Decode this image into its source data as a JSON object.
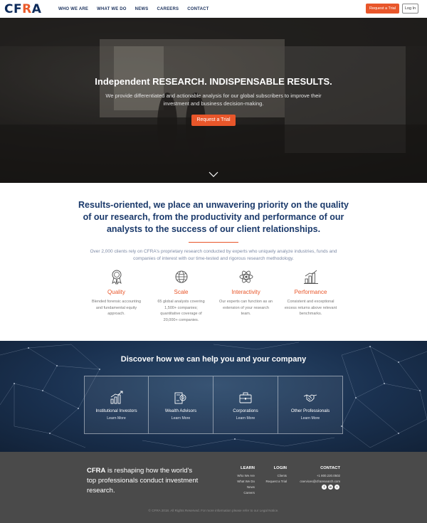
{
  "nav": {
    "logo_main": "CF",
    "logo_accent": "R",
    "logo_end": "A",
    "links": [
      "WHO WE ARE",
      "WHAT WE DO",
      "NEWS",
      "CAREERS",
      "CONTACT"
    ],
    "trial_label": "Request a Trial",
    "login_label": "Log In"
  },
  "hero": {
    "title": "Independent RESEARCH. INDISPENSABLE RESULTS.",
    "subtitle": "We provide differentiated and actionable analysis for our global subscribers to improve their investment and business decision-making.",
    "cta_label": "Request a Trial"
  },
  "results": {
    "heading": "Results-oriented, we place an unwavering priority on the quality of our research, from the productivity and performance of our analysts to the success of our client relationships.",
    "body": "Over 2,000 clients rely on CFRA's proprietary research conducted by experts who uniquely analyze industries, funds and companies of interest with our time-tested and rigorous research methodology.",
    "features": [
      {
        "title": "Quality",
        "desc": "Blended forensic accounting and fundamental equity approach.",
        "icon": "award-ribbon-icon"
      },
      {
        "title": "Scale",
        "desc": "65 global analysts covering 1,500+ companies; quantitative coverage of 20,000+ companies.",
        "icon": "globe-icon"
      },
      {
        "title": "Interactivity",
        "desc": "Our experts can function as an extension of your research team.",
        "icon": "atom-icon"
      },
      {
        "title": "Performance",
        "desc": "Consistent and exceptional excess returns above relevant benchmarks.",
        "icon": "bar-chart-icon"
      }
    ]
  },
  "discover": {
    "title": "Discover how we can help you and your company",
    "cards": [
      {
        "title": "Institutional Investors",
        "more": "Learn More",
        "icon": "growth-chart-icon"
      },
      {
        "title": "Wealth Advisors",
        "more": "Learn More",
        "icon": "wealth-gear-icon"
      },
      {
        "title": "Corporations",
        "more": "Learn More",
        "icon": "briefcase-icon"
      },
      {
        "title": "Other Professionals",
        "more": "Learn More",
        "icon": "handshake-icon"
      }
    ]
  },
  "footer": {
    "tag_brand": "CFRA",
    "tag_rest": " is reshaping how the world's top professionals conduct investment research.",
    "learn": {
      "heading": "LEARN",
      "links": [
        "Who We Are",
        "What We Do",
        "News",
        "Careers"
      ]
    },
    "login": {
      "heading": "LOGIN",
      "links": [
        "Clients",
        "Request a Trial"
      ]
    },
    "contact": {
      "heading": "CONTACT",
      "links": [
        "+1 800.220.0502",
        "cservices@cfraresearch.com"
      ]
    },
    "social": [
      "f",
      "in",
      "t"
    ],
    "copyright": "© CFRA 2018. All Rights Reserved. For more information please refer to our Legal Notice."
  },
  "colors": {
    "accent": "#e8562a",
    "navy": "#1b3a6b",
    "footer": "#4a4a4a"
  }
}
